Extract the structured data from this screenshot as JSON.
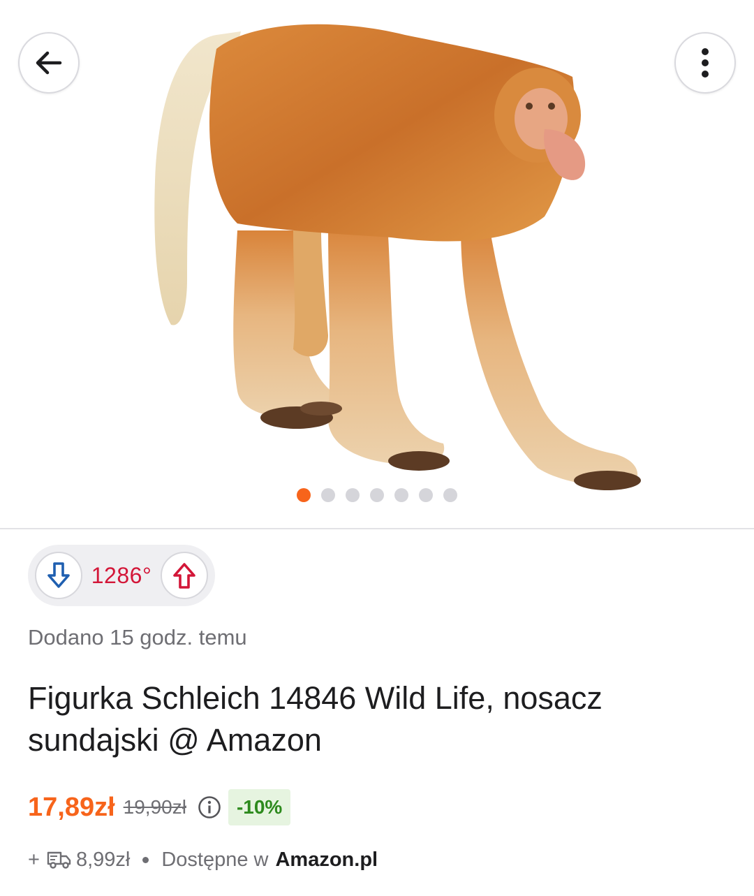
{
  "header": {
    "back_icon": "arrow-left-icon",
    "menu_icon": "more-vertical-icon"
  },
  "gallery": {
    "image_subject": "proboscis-monkey-figurine",
    "total_images": 7,
    "active_index": 0,
    "active_color": "#f7641b"
  },
  "vote": {
    "down_icon": "arrow-down-icon",
    "temperature": "1286°",
    "up_icon": "arrow-up-icon",
    "temperature_color": "#d31638"
  },
  "deal": {
    "posted": "Dodano 15 godz. temu",
    "title": "Figurka Schleich 14846 Wild Life, nosacz sundajski @ Amazon",
    "price": "17,89zł",
    "old_price": "19,90zł",
    "discount": "-10%",
    "accent_color": "#f7641b",
    "shipping_prefix": "+",
    "shipping_icon": "truck-icon",
    "shipping_cost": "8,99zł",
    "availability_label": "Dostępne w",
    "merchant": "Amazon.pl"
  }
}
